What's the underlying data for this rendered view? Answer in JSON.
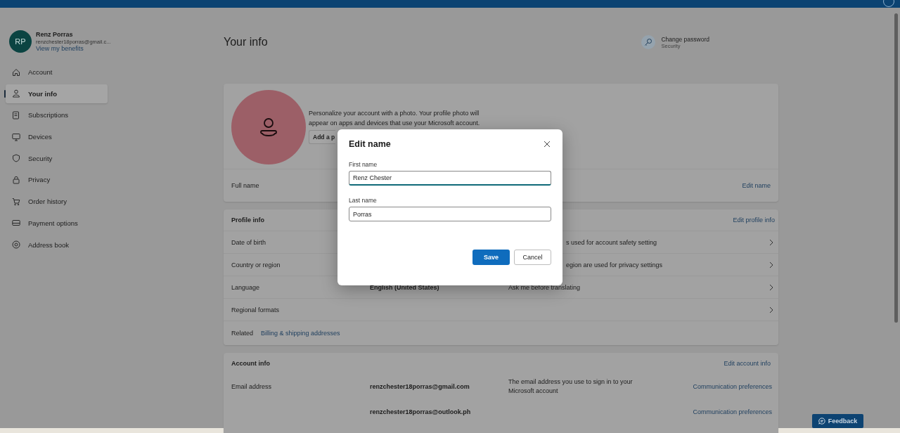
{
  "sidebar": {
    "initials": "RP",
    "name": "Renz Porras",
    "email": "renzchester18porras@gmail.c...",
    "benefits_link": "View my benefits",
    "items": [
      {
        "label": "Account",
        "selected": false
      },
      {
        "label": "Your info",
        "selected": true
      },
      {
        "label": "Subscriptions",
        "selected": false
      },
      {
        "label": "Devices",
        "selected": false
      },
      {
        "label": "Security",
        "selected": false
      },
      {
        "label": "Privacy",
        "selected": false
      },
      {
        "label": "Order history",
        "selected": false
      },
      {
        "label": "Payment options",
        "selected": false
      },
      {
        "label": "Address book",
        "selected": false
      }
    ]
  },
  "page_title": "Your info",
  "change_password": {
    "title": "Change password",
    "subtitle": "Security"
  },
  "photo_card": {
    "text": "Personalize your account with a photo. Your profile photo will appear on apps and devices that use your Microsoft account.",
    "add_button": "Add a p",
    "full_name_label": "Full name",
    "edit_link": "Edit name"
  },
  "profile_info": {
    "title": "Profile info",
    "edit_link": "Edit profile info",
    "rows": [
      {
        "label": "Date of birth",
        "desc": "s used for account safety setting"
      },
      {
        "label": "Country or region",
        "desc": "egion are used for privacy settings"
      },
      {
        "label": "Language",
        "value": "English (United States)",
        "desc": "Ask me before translating"
      },
      {
        "label": "Regional formats"
      }
    ],
    "related_label": "Related",
    "related_link": "Billing & shipping addresses"
  },
  "account_info": {
    "title": "Account info",
    "edit_link": "Edit account info",
    "rows": [
      {
        "label": "Email address",
        "value": "renzchester18porras@gmail.com",
        "desc": "The email address you use to sign in to your Microsoft account",
        "link": "Communication preferences"
      },
      {
        "value": "renzchester18porras@outlook.ph",
        "link": "Communication preferences"
      }
    ]
  },
  "feedback_button": "Feedback",
  "dialog": {
    "title": "Edit name",
    "fields": [
      {
        "label": "First name",
        "value": "Renz Chester",
        "focused": true
      },
      {
        "label": "Last name",
        "value": "Porras",
        "focused": false
      }
    ],
    "save": "Save",
    "cancel": "Cancel"
  }
}
